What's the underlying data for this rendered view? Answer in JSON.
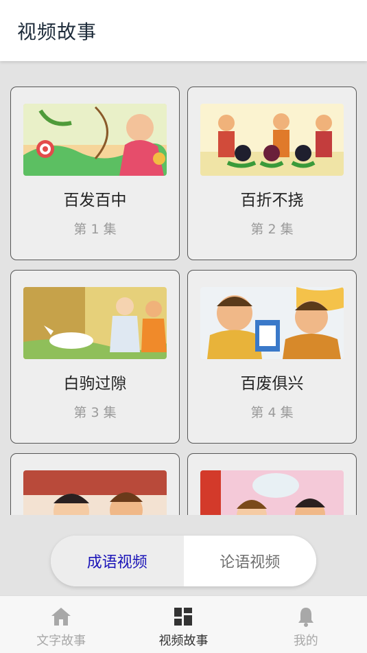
{
  "header": {
    "title": "视频故事"
  },
  "videos": [
    {
      "title": "百发百中",
      "episode": "第 1 集"
    },
    {
      "title": "百折不挠",
      "episode": "第 2 集"
    },
    {
      "title": "白驹过隙",
      "episode": "第 3 集"
    },
    {
      "title": "百废俱兴",
      "episode": "第 4 集"
    }
  ],
  "segment": {
    "left": "成语视频",
    "right": "论语视频",
    "active": "left"
  },
  "tabbar": {
    "items": [
      {
        "label": "文字故事",
        "icon": "home-icon"
      },
      {
        "label": "视频故事",
        "icon": "grid-icon"
      },
      {
        "label": "我的",
        "icon": "bell-icon"
      }
    ],
    "active": 1
  },
  "colors": {
    "segment_active_text": "#1a14b8",
    "tab_active": "#333333",
    "tab_inactive": "#a8a8a8"
  }
}
